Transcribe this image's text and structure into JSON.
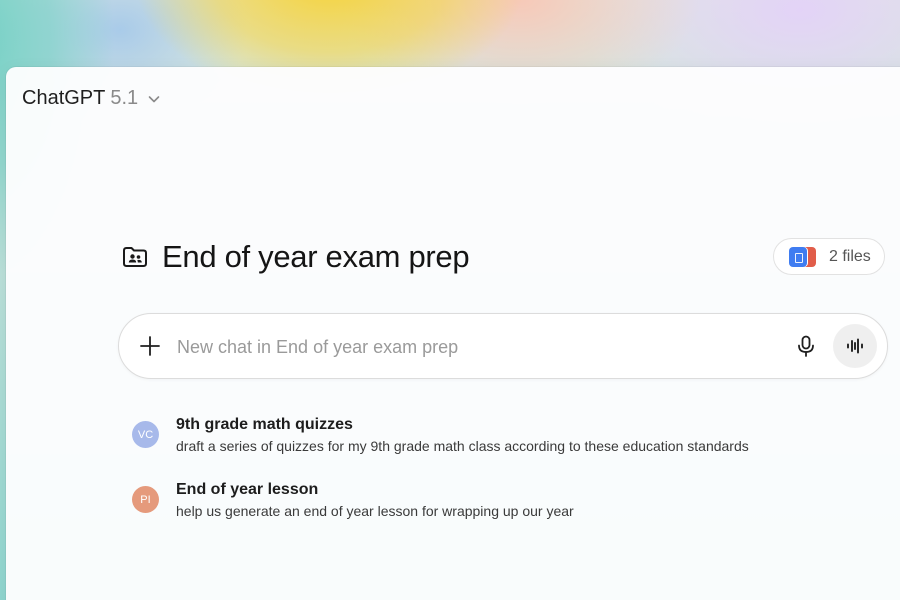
{
  "header": {
    "app_name": "ChatGPT",
    "model_version": "5.1"
  },
  "project": {
    "title": "End of year exam prep",
    "files_label": "2 files"
  },
  "composer": {
    "placeholder": "New chat in End of year exam prep"
  },
  "chats": [
    {
      "initials": "VC",
      "avatar_color": "#a7b9ea",
      "title": "9th grade math quizzes",
      "preview": "draft a series of quizzes for my 9th grade math class according to these education standards"
    },
    {
      "initials": "PI",
      "avatar_color": "#e59a7c",
      "title": "End of year lesson",
      "preview": "help us generate an end of year lesson for wrapping up our year"
    }
  ]
}
